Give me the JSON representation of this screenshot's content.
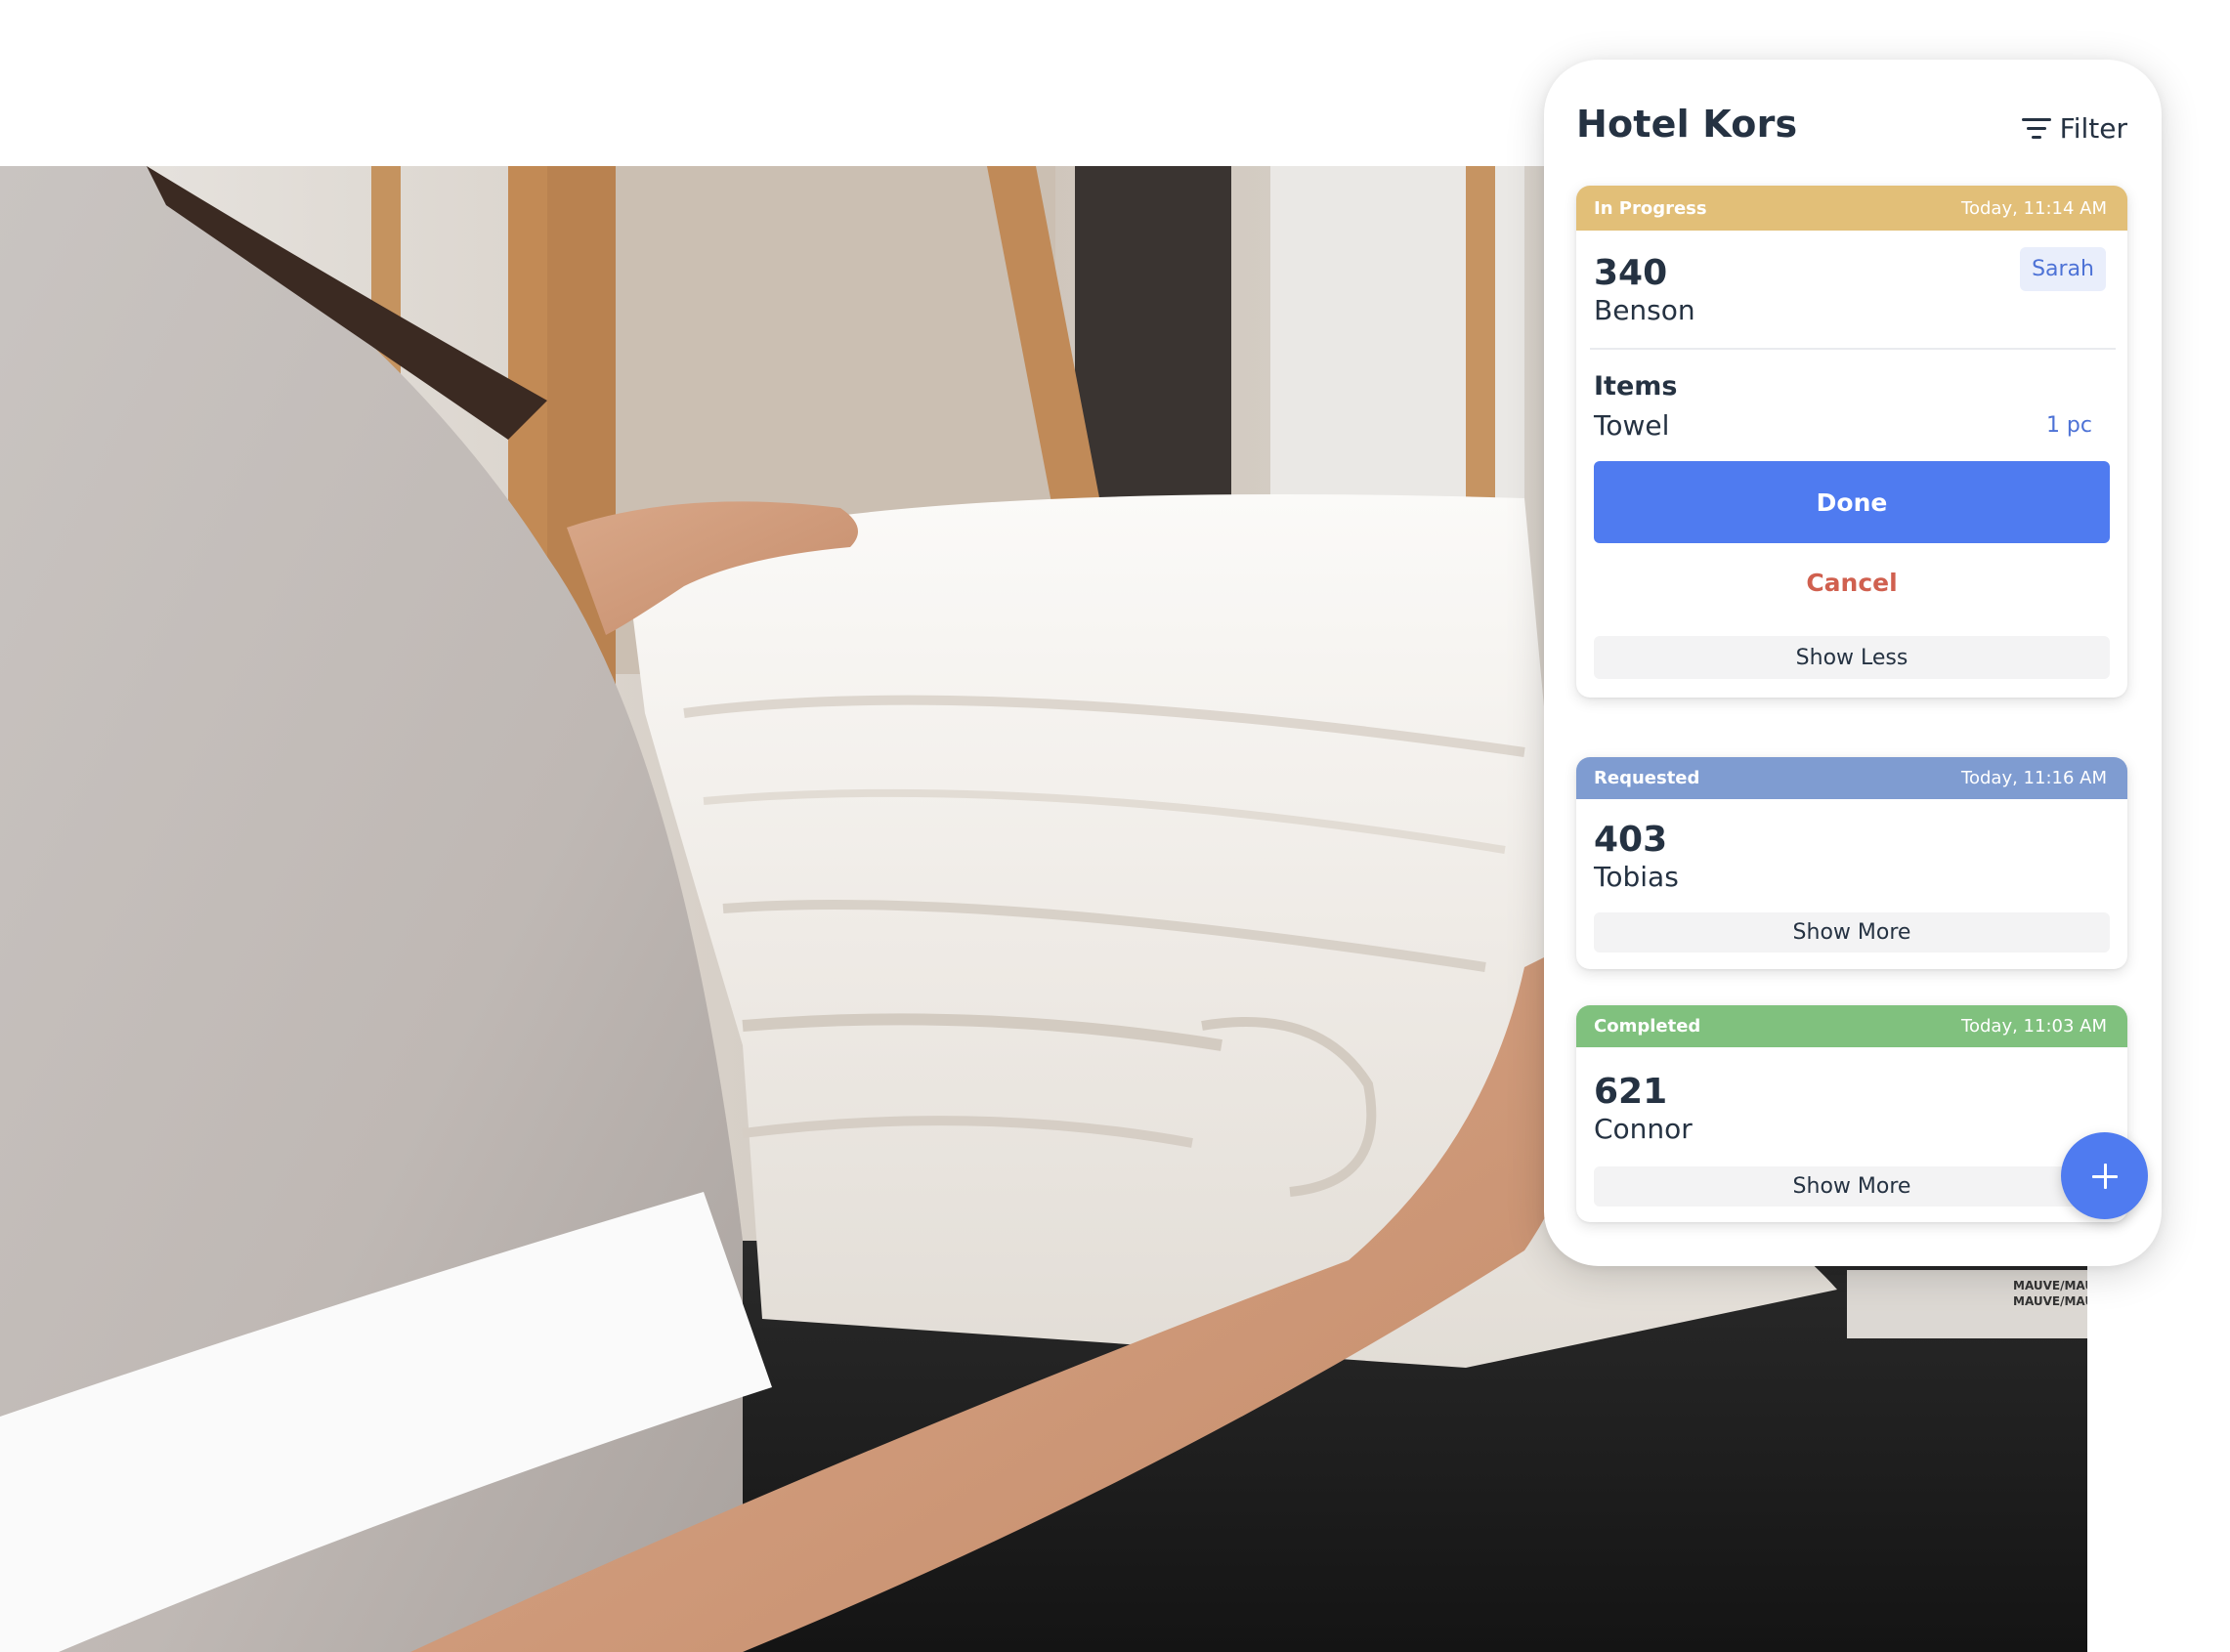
{
  "panel": {
    "title": "Hotel Kors",
    "filter_label": "Filter",
    "filter_icon": "filter-icon",
    "add_button_icon": "plus-icon"
  },
  "requests": [
    {
      "status": "In Progress",
      "status_color": "#E2BF78",
      "time": "Today, 11:14 AM",
      "room": "340",
      "guest": "Benson",
      "assignee": "Sarah",
      "expanded": true,
      "items_heading": "Items",
      "items": [
        {
          "name": "Towel",
          "quantity": "1 pc"
        }
      ],
      "done_label": "Done",
      "cancel_label": "Cancel",
      "toggle_label": "Show Less"
    },
    {
      "status": "Requested",
      "status_color": "#7F9CD1",
      "time": "Today, 11:16 AM",
      "room": "403",
      "guest": "Tobias",
      "expanded": false,
      "toggle_label": "Show More"
    },
    {
      "status": "Completed",
      "status_color": "#80C17E",
      "time": "Today, 11:03 AM",
      "room": "621",
      "guest": "Connor",
      "expanded": false,
      "toggle_label": "Show More"
    }
  ],
  "colors": {
    "primary": "#4F7BF0",
    "danger": "#D0604F",
    "text": "#253242",
    "assignee_bg": "#E9EEFB"
  },
  "photo": {
    "description": "Housekeeper in gray uniform holding a stack of white towels",
    "label_text": "MAUVE/MAUVE"
  }
}
